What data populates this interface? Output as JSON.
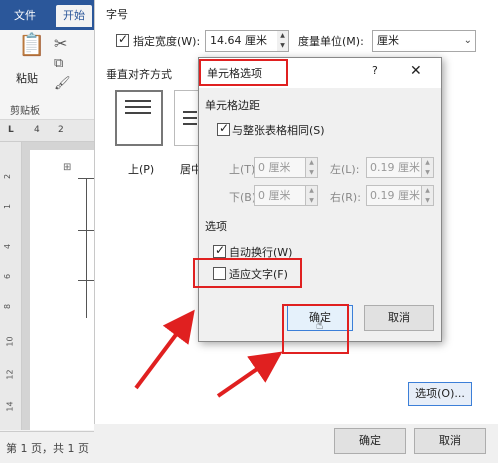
{
  "word": {
    "tabs": [
      "文件",
      "开始"
    ],
    "paste_label": "粘贴",
    "clipboard_label": "剪贴板",
    "ruler_marks": [
      "L",
      "4",
      "2"
    ],
    "vruler_marks": [
      "2",
      "1",
      "4",
      "6",
      "8",
      "10",
      "12",
      "14"
    ],
    "status_text": "第 1 页，共 1 页"
  },
  "parent_dialog": {
    "section_font": "字号",
    "preferred_width_label": "指定宽度(W):",
    "preferred_width_checked": true,
    "preferred_width_value": "14.64 厘米",
    "measure_label": "度量单位(M):",
    "measure_value": "厘米",
    "section_valign": "垂直对齐方式",
    "valign_top": "上(P)",
    "valign_center": "居中",
    "options_button": "选项(O)...",
    "ok": "确定",
    "cancel": "取消"
  },
  "cell_options": {
    "title": "单元格选项",
    "help": "?",
    "close": "✕",
    "margins_group": "单元格边距",
    "same_as_table": "与整张表格相同(S)",
    "same_as_table_checked": true,
    "top_label": "上(T):",
    "top_value": "0 厘米",
    "left_label": "左(L):",
    "left_value": "0.19 厘米",
    "bottom_label": "下(B):",
    "bottom_value": "0 厘米",
    "right_label": "右(R):",
    "right_value": "0.19 厘米",
    "options_group": "选项",
    "wrap_text": "自动换行(W)",
    "wrap_text_checked": true,
    "fit_text": "适应文字(F)",
    "fit_text_checked": false,
    "ok": "确定",
    "cancel": "取消"
  },
  "colors": {
    "highlight": "#e02020",
    "word_blue": "#2b579a"
  }
}
